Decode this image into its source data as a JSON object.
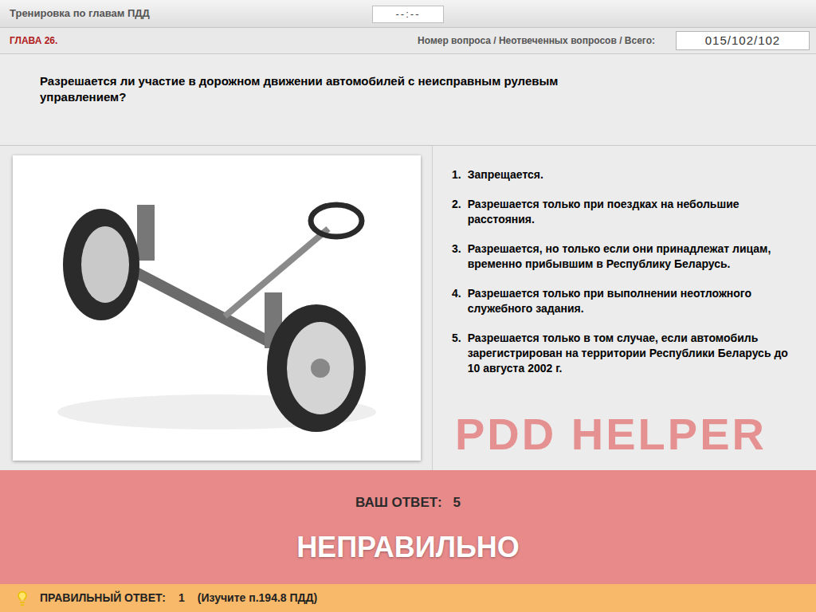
{
  "header": {
    "title": "Тренировка по главам ПДД",
    "timer": "--:--"
  },
  "chapter": {
    "label": "ГЛАВА 26.",
    "counter_label": "Номер вопроса / Неотвеченных вопросов / Всего:",
    "counter": "015/102/102"
  },
  "question": "Разрешается ли участие в дорожном движении автомобилей с неисправным рулевым управлением?",
  "answers": [
    {
      "number": "1.",
      "text": "Запрещается."
    },
    {
      "number": "2.",
      "text": "Разрешается только при поездках на небольшие расстояния."
    },
    {
      "number": "3.",
      "text": "Разрешается, но только если они принадлежат лицам, временно прибывшим в Республику Беларусь."
    },
    {
      "number": "4.",
      "text": "Разрешается только при выполнении неотложного служебного задания."
    },
    {
      "number": "5.",
      "text": "Разрешается только в том случае, если автомобиль зарегистрирован на территории Республики Беларусь до 10 августа 2002 г."
    }
  ],
  "watermark": "PDD HELPER",
  "result": {
    "your_answer_label": "ВАШ ОТВЕТ:",
    "your_answer": "5",
    "verdict": "НЕПРАВИЛЬНО",
    "correct": false
  },
  "hint": {
    "label": "ПРАВИЛЬНЫЙ ОТВЕТ:",
    "answer": "1",
    "reference": "(Изучите п.194.8 ПДД)"
  }
}
